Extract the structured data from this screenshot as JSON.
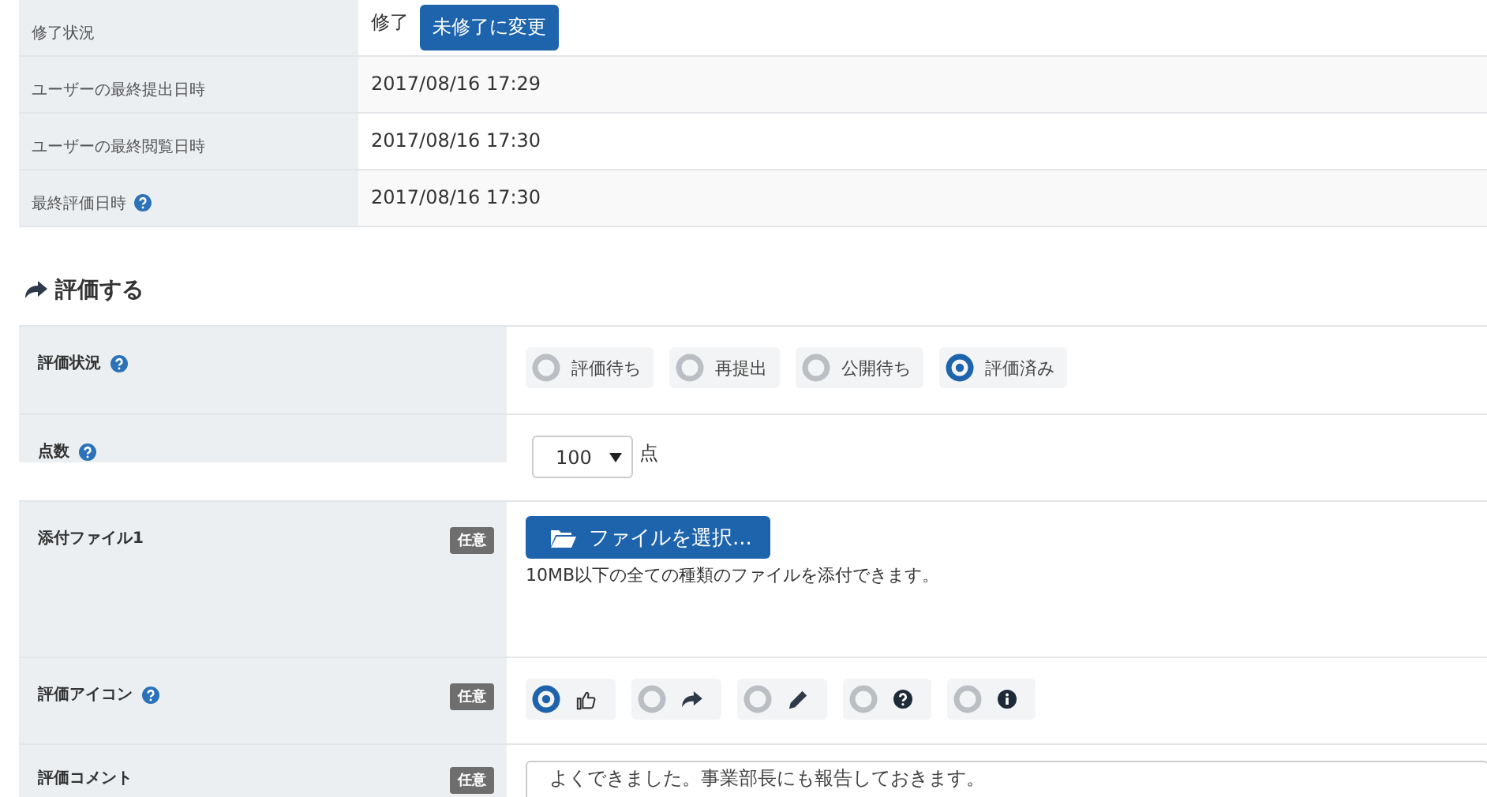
{
  "info_rows": [
    {
      "label": "修了状況",
      "value": "修了",
      "button": "未修了に変更",
      "help": false
    },
    {
      "label": "ユーザーの最終提出日時",
      "value": "2017/08/16 17:29",
      "help": false
    },
    {
      "label": "ユーザーの最終閲覧日時",
      "value": "2017/08/16 17:30",
      "help": false
    },
    {
      "label": "最終評価日時",
      "value": "2017/08/16 17:30",
      "help": true
    }
  ],
  "section_title": "評価する",
  "form_rows": [
    {
      "kind": "status",
      "label": "評価状況",
      "help": true,
      "options": [
        {
          "label": "評価待ち",
          "selected": false
        },
        {
          "label": "再提出",
          "selected": false
        },
        {
          "label": "公開待ち",
          "selected": false
        },
        {
          "label": "評価済み",
          "selected": true
        }
      ]
    },
    {
      "kind": "score",
      "label": "点数",
      "help": true,
      "value": "100",
      "unit": "点"
    },
    {
      "kind": "file",
      "label": "添付ファイル1",
      "help": false,
      "badge": "任意",
      "button": "ファイルを選択...",
      "note": "10MB以下の全ての種類のファイルを添付できます。"
    },
    {
      "kind": "icons",
      "label": "評価アイコン",
      "help": true,
      "badge": "任意",
      "options": [
        {
          "selected": true
        },
        {
          "selected": false
        },
        {
          "selected": false
        },
        {
          "selected": false
        },
        {
          "selected": false
        }
      ]
    },
    {
      "kind": "comment",
      "label": "評価コメント",
      "help": false,
      "badge": "任意",
      "value": "よくできました。事業部長にも報告しておきます。"
    }
  ]
}
